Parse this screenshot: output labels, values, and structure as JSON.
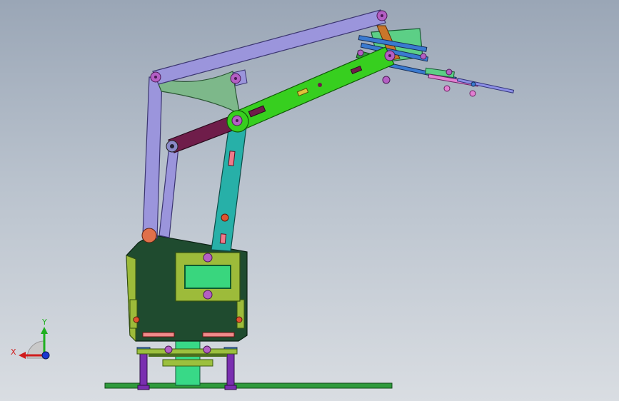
{
  "triad": {
    "x_label": "X",
    "y_label": "Y"
  },
  "colors": {
    "background_top": "#9aa6b6",
    "background_bottom": "#d9dde2",
    "upper_link": "#9b95dc",
    "triangle_plate": "#7db88a",
    "forearm": "#37cf1f",
    "upper_arm": "#27b0a8",
    "crank": "#6f1d4a",
    "base_body": "#1f4b2f",
    "base_panel": "#9dbb3a",
    "base_screen": "#39d67e",
    "turntable_plate": "#9cc03e",
    "column": "#38d987",
    "baseplate": "#2f9a3c",
    "standoff": "#7a2fb0",
    "screw": "#b45fc4",
    "gripper_block": "#5ccf86",
    "gripper_bar": "#3a7ad0",
    "gripper_pink": "#e27fd2",
    "gripper_rod": "#8c8fe6",
    "axis_x": "#d01c1c",
    "axis_y": "#1fb01f",
    "axis_z": "#1a38d0"
  }
}
